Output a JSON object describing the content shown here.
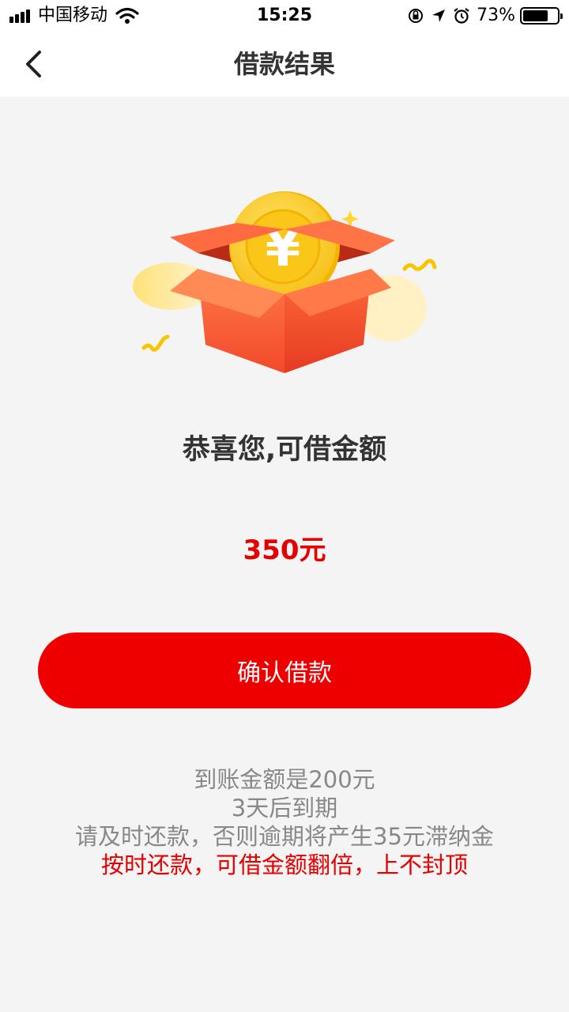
{
  "status_bar": {
    "carrier": "中国移动",
    "time": "15:25",
    "battery": "73%",
    "battery_level": 0.73
  },
  "nav": {
    "title": "借款结果"
  },
  "result": {
    "congrats": "恭喜您,可借金额",
    "amount": "350元"
  },
  "confirm_button": "确认借款",
  "notes": {
    "line1": "到账金额是200元",
    "line2": "3天后到期",
    "line3": "请及时还款，否则逾期将产生35元滞纳金",
    "line4": "按时还款，可借金额翻倍，上不封顶"
  },
  "colors": {
    "accent": "#ee0000",
    "amount": "#e50000",
    "box": "#ff6a3d",
    "coin": "#ffd633"
  },
  "illustration_icons": [
    "gift-box-icon",
    "yuan-coin-icon"
  ]
}
